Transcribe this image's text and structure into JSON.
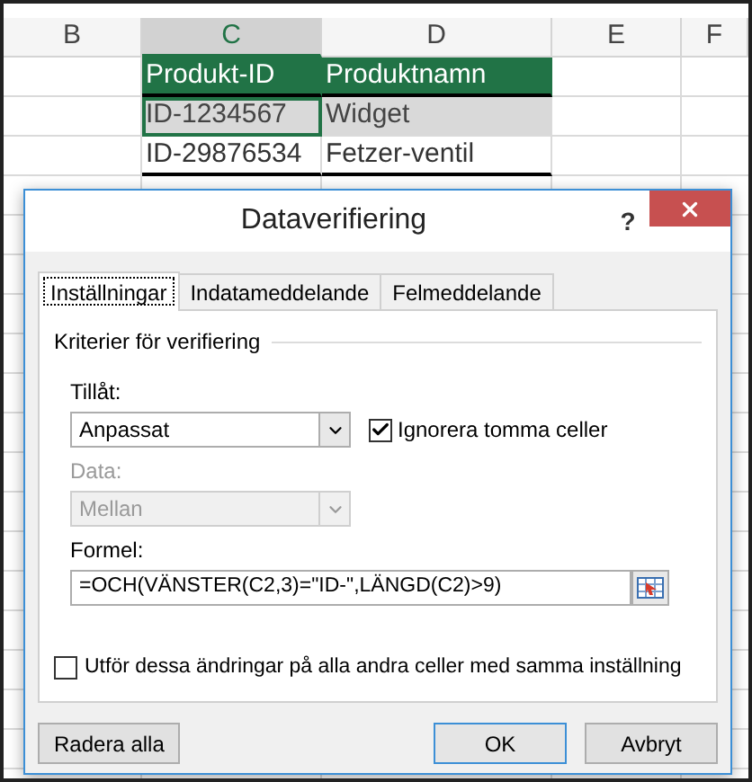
{
  "sheet": {
    "columns": [
      {
        "label": "B",
        "selected": false
      },
      {
        "label": "C",
        "selected": true
      },
      {
        "label": "D",
        "selected": false
      },
      {
        "label": "E",
        "selected": false
      },
      {
        "label": "F",
        "selected": false
      }
    ],
    "rows": [
      {
        "kind": "header",
        "cells": [
          "",
          "Produkt-ID",
          "Produktnamn",
          "",
          ""
        ]
      },
      {
        "kind": "data",
        "selected": true,
        "cells": [
          "",
          "ID-1234567",
          "Widget",
          "",
          ""
        ]
      },
      {
        "kind": "data",
        "selected": false,
        "cells": [
          "",
          "ID-29876534",
          "Fetzer-ventil",
          "",
          ""
        ]
      }
    ]
  },
  "dialog": {
    "title": "Dataverifiering",
    "help": "?",
    "tabs": [
      {
        "label": "Inställningar",
        "selected": true
      },
      {
        "label": "Indatameddelande",
        "selected": false
      },
      {
        "label": "Felmeddelande",
        "selected": false
      }
    ],
    "section": "Kriterier för verifiering",
    "allow": {
      "label": "Tillåt:",
      "value": "Anpassat",
      "disabled": false
    },
    "ignore_blank": {
      "label": "Ignorera tomma celler",
      "checked": true
    },
    "data": {
      "label": "Data:",
      "value": "Mellan",
      "disabled": true
    },
    "formula": {
      "label": "Formel:",
      "value": "=OCH(VÄNSTER(C2,3)=\"ID-\",LÄNGD(C2)>9)"
    },
    "apply_all": {
      "label": "Utför dessa ändringar på alla andra celler med samma inställning",
      "checked": false
    },
    "buttons": [
      {
        "label": "Radera alla",
        "kind": "left"
      },
      {
        "label": "OK",
        "kind": "default"
      },
      {
        "label": "Avbryt",
        "kind": "normal"
      }
    ]
  }
}
